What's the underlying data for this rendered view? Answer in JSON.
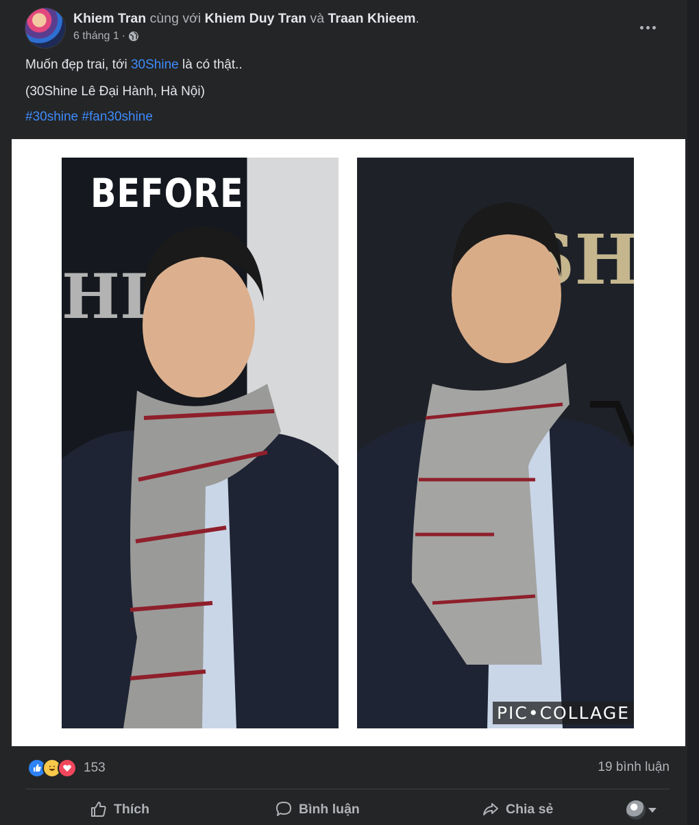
{
  "post": {
    "author": "Khiem Tran",
    "with_text": "cùng với",
    "tagged_1": "Khiem Duy Tran",
    "and_text": "và",
    "tagged_2": "Traan Khieem",
    "period": ".",
    "date": "6 tháng 1",
    "separator": "·",
    "privacy_icon": "globe-icon",
    "text_prefix": "Muốn đẹp trai, tới",
    "text_link": "30Shine",
    "text_suffix": "là có thật..",
    "location_text": "(30Shine Lê Đại Hành, Hà Nội)",
    "hashtags": [
      "#30shine",
      "#fan30shine"
    ]
  },
  "photo": {
    "left_label": "BEFORE",
    "watermark": "PIC•COLLAGE"
  },
  "reactions": {
    "icons": [
      "like-reaction-icon",
      "haha-reaction-icon",
      "love-reaction-icon"
    ],
    "count": "153",
    "comments": "19 bình luận"
  },
  "actions": {
    "like": "Thích",
    "comment": "Bình luận",
    "share": "Chia sẻ"
  },
  "colors": {
    "background": "#242526",
    "link": "#3d8bfd",
    "text": "#e4e6eb",
    "muted": "#b0b3b8"
  }
}
